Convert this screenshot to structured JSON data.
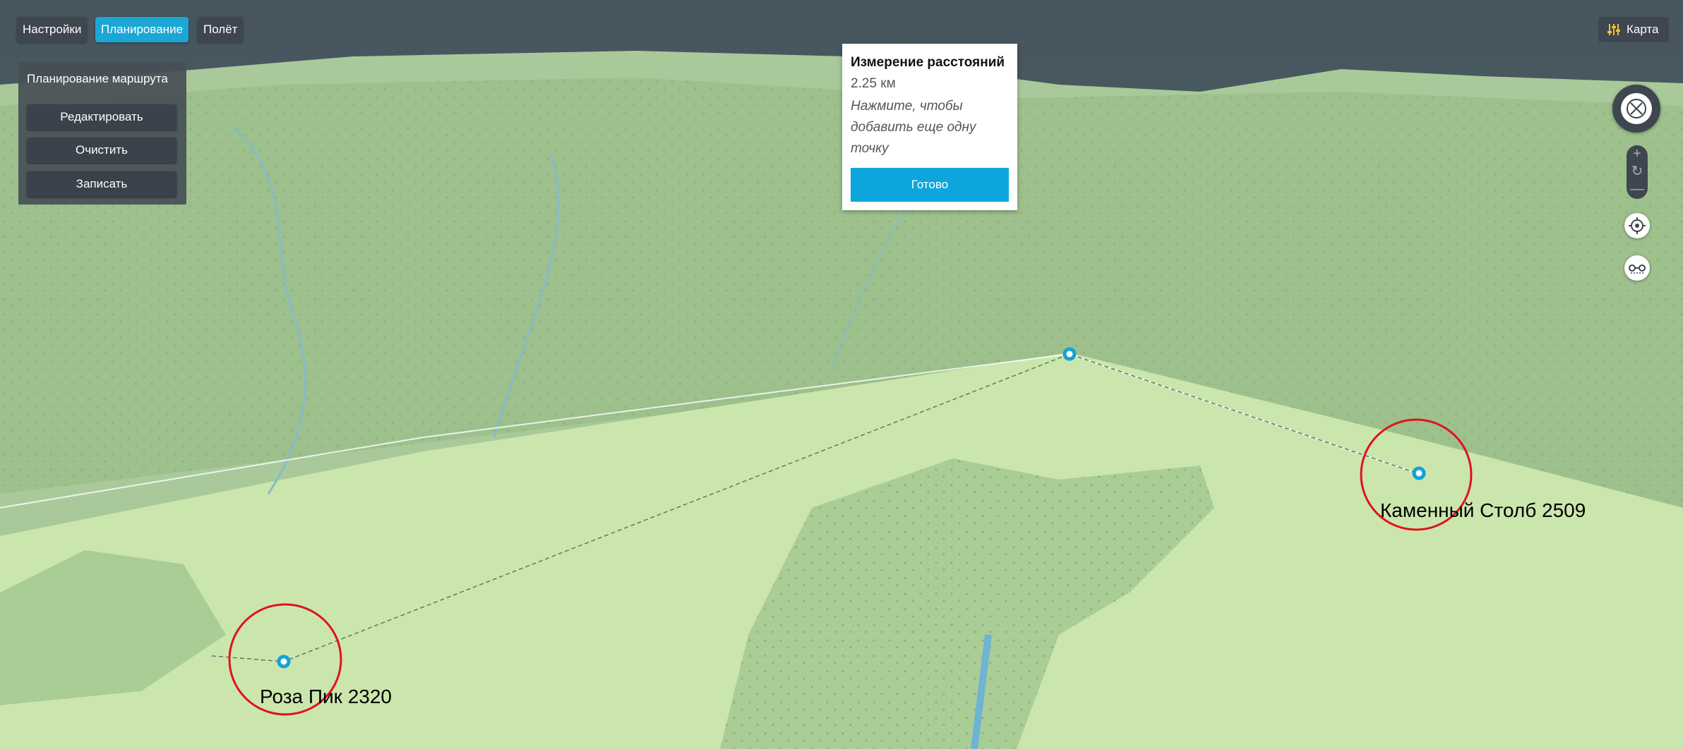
{
  "tabs": [
    {
      "label": "Настройки",
      "active": false
    },
    {
      "label": "Планирование",
      "active": true
    },
    {
      "label": "Полёт",
      "active": false
    }
  ],
  "panel": {
    "title": "Планирование маршрута",
    "buttons": [
      "Редактировать",
      "Очистить",
      "Записать"
    ]
  },
  "map_button": {
    "label": "Карта",
    "icon": "sliders-icon"
  },
  "measure": {
    "title": "Измерение расстояний",
    "distance": "2.25 км",
    "hint": "Нажмите, чтобы добавить еще одну точку",
    "done_label": "Готово"
  },
  "controls": {
    "compass_icon": "compass-icon",
    "zoom_in": "+",
    "rotate": "↻",
    "zoom_out": "—",
    "locate_icon": "locate-icon",
    "route_icon": "route-icon"
  },
  "points": [
    {
      "name": "Роза Пик 2320"
    },
    {
      "name": "Каменный Столб 2509"
    }
  ],
  "colors": {
    "accent": "#1ba7d6",
    "panel": "#3f4650",
    "circle": "#e0121b",
    "sky": "#47575f"
  }
}
